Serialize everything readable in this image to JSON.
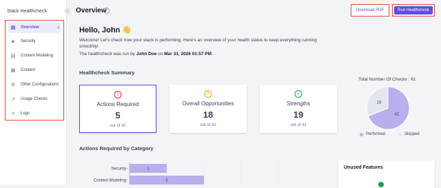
{
  "app": {
    "title": "Stack Healthcheck"
  },
  "sidebar": {
    "items": [
      {
        "label": "Overview",
        "icon": "overview-icon"
      },
      {
        "label": "Security",
        "icon": "shield-icon"
      },
      {
        "label": "Content Modeling",
        "icon": "content-model-icon"
      },
      {
        "label": "Content",
        "icon": "content-icon"
      },
      {
        "label": "Other Configurations",
        "icon": "settings-icon"
      },
      {
        "label": "Usage Checks",
        "icon": "chart-line-icon"
      },
      {
        "label": "Logs",
        "icon": "logs-icon"
      }
    ]
  },
  "header": {
    "title": "Overview",
    "download_pdf": "Download PDF",
    "run_healthcheck": "Run Healthcheck"
  },
  "main": {
    "greeting": "Hello, John 👋",
    "welcome": "Welcome! Let's check how your stack is performing. Here's an overview of your health status to keep everything running smoothly!",
    "run_prefix": "The healthcheck was run by ",
    "run_user": "John Doe",
    "run_on": " on ",
    "run_date": "Mar 31, 2026 01:57 PM",
    "run_suffix": ".",
    "summary_title": "Healthcheck Summary",
    "cards": [
      {
        "title": "Actions Required",
        "value": "5",
        "sub": "out of 42",
        "icon": "alert-icon",
        "color": "#dc2626"
      },
      {
        "title": "Overall Opportunities",
        "value": "18",
        "sub": "out of 42",
        "icon": "question-icon",
        "color": "#f59e0b"
      },
      {
        "title": "Strengths",
        "value": "19",
        "sub": "out of 42",
        "icon": "check-circle-icon",
        "color": "#16a34a"
      }
    ],
    "category_title": "Actions Required by Category",
    "unused_title": "Unused Features"
  },
  "total_checks": {
    "title": "Total Number Of Checks : 61",
    "legend_performed": "Performed",
    "legend_skipped": "Skipped",
    "colors": {
      "performed": "#b7b0ec",
      "skipped": "#e5e7ef"
    }
  },
  "chart_data": [
    {
      "type": "pie",
      "labels": [
        "Performed",
        "Skipped"
      ],
      "values": [
        42,
        19
      ]
    },
    {
      "type": "bar",
      "title": "Actions Required by Category",
      "categories": [
        "Security",
        "Content Modeling"
      ],
      "values": [
        1,
        2
      ]
    }
  ]
}
